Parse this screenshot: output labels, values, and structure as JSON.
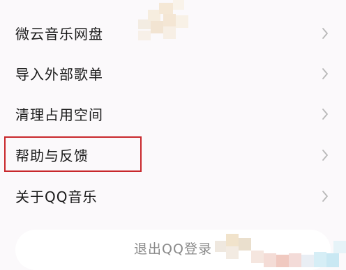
{
  "menu": {
    "items": [
      {
        "label": "微云音乐网盘"
      },
      {
        "label": "导入外部歌单"
      },
      {
        "label": "清理占用空间"
      },
      {
        "label": "帮助与反馈"
      },
      {
        "label": "关于QQ音乐"
      }
    ]
  },
  "logout": {
    "label": "退出QQ登录"
  },
  "icons": {
    "chevron": "chevron-right-icon"
  },
  "colors": {
    "background": "#fbf9fb",
    "text": "#1a1a1a",
    "chevron": "#b8b8b8",
    "highlight": "#c8282c",
    "logout_text": "#8a8a8a"
  }
}
